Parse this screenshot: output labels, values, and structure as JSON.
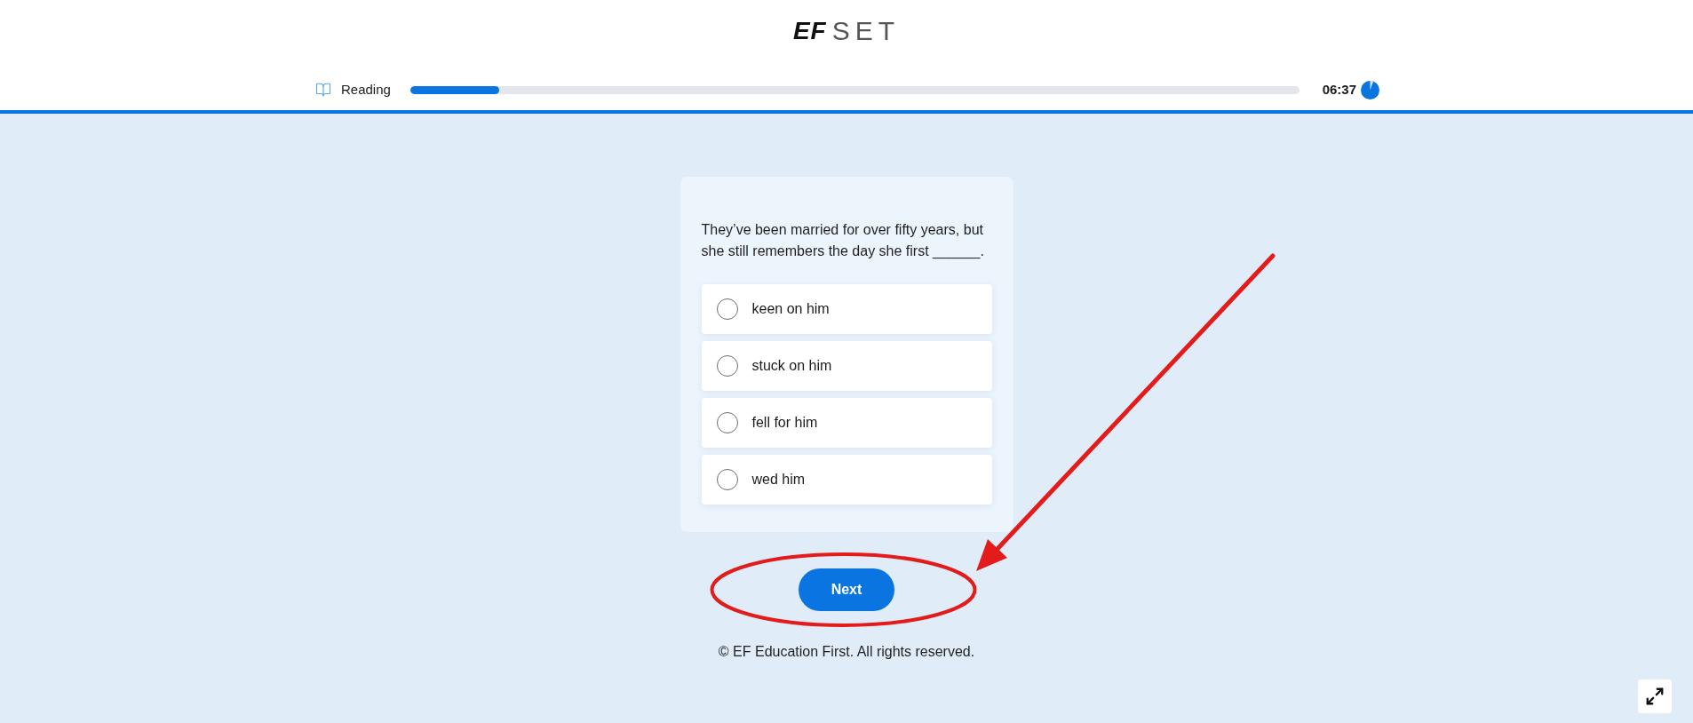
{
  "header": {
    "logo": {
      "mark": "EF",
      "word": "SET"
    }
  },
  "progress": {
    "section": "Reading",
    "level": 0.1,
    "time": "06:37"
  },
  "question": {
    "text": "They’ve been married for over fifty years, but she still remembers the day she first ______.",
    "options": [
      {
        "label": "keen on him",
        "selected": false
      },
      {
        "label": "stuck on him",
        "selected": false
      },
      {
        "label": "fell for him",
        "selected": false
      },
      {
        "label": "wed him",
        "selected": false
      }
    ]
  },
  "next_button": "Next",
  "footer": "© EF Education First. All rights reserved."
}
